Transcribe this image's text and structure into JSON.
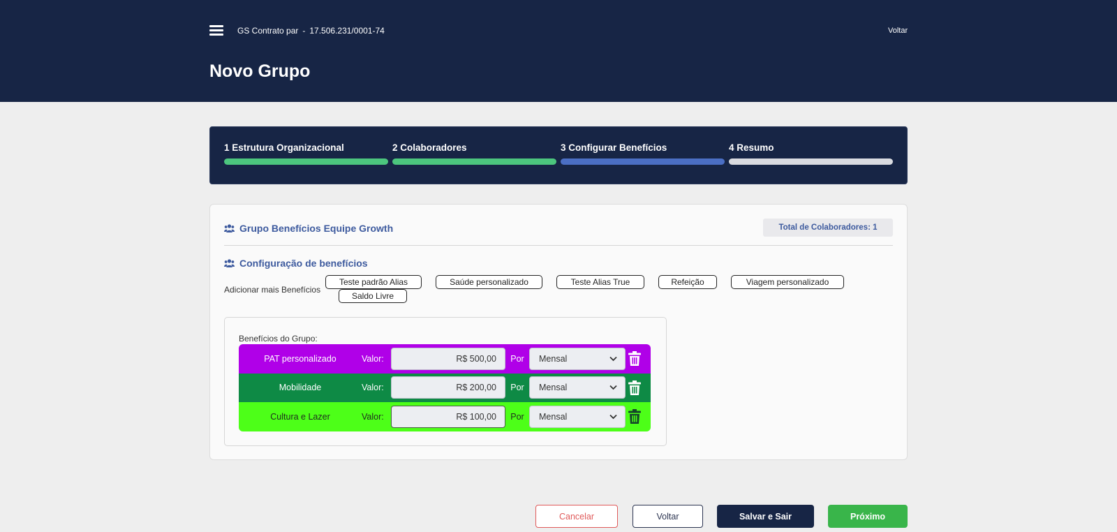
{
  "header": {
    "menu_icon": "hamburger-menu-icon",
    "company_name": "GS Contrato par",
    "separator": "-",
    "company_cnpj": "17.506.231/0001-74",
    "back_link": "Voltar",
    "title": "Novo Grupo",
    "background_color": "#172545"
  },
  "stepper": {
    "steps": [
      {
        "label": "1 Estrutura Organizacional",
        "status": "done",
        "color": "#4cc67e"
      },
      {
        "label": "2 Colaboradores",
        "status": "done",
        "color": "#4cc67e"
      },
      {
        "label": "3 Configurar Benefícios",
        "status": "current",
        "color": "#4b6fc4"
      },
      {
        "label": "4 Resumo",
        "status": "pending",
        "color": "#d9dbe0"
      }
    ]
  },
  "group": {
    "icon": "users-icon",
    "title": "Grupo Benefícios Equipe Growth",
    "total_label": "Total de Colaboradores: 1"
  },
  "config": {
    "icon": "users-icon",
    "title": "Configuração de benefícios",
    "add_label": "Adicionar mais Benefícios",
    "chips": [
      "Teste padrão Alias",
      "Saúde personalizado",
      "Teste Alias True",
      "Refeição",
      "Viagem personalizado",
      "Saldo Livre"
    ]
  },
  "benefits": {
    "title": "Benefícios do Grupo:",
    "valor_label": "Valor:",
    "por_label": "Por",
    "rows": [
      {
        "name": "PAT personalizado",
        "value": "R$ 500,00",
        "period": "Mensal",
        "color": "#b000e8",
        "text_color": "#ffffff"
      },
      {
        "name": "Mobilidade",
        "value": "R$ 200,00",
        "period": "Mensal",
        "color": "#0e8a45",
        "text_color": "#ffffff"
      },
      {
        "name": "Cultura e Lazer",
        "value": "R$ 100,00",
        "period": "Mensal",
        "color": "#4dff18",
        "text_color": "#1f2a1f"
      }
    ]
  },
  "footer": {
    "cancel": "Cancelar",
    "back": "Voltar",
    "save_exit": "Salvar e Sair",
    "next": "Próximo"
  }
}
